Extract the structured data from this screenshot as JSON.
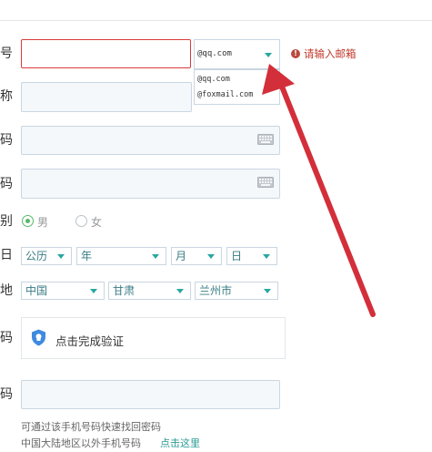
{
  "form": {
    "labels": {
      "email": "号",
      "nickname": "称",
      "password": "码",
      "confirm_password": "码",
      "gender": "别",
      "birthday": "日",
      "location": "地",
      "verify": "码",
      "phone": "码"
    },
    "email": {
      "input_value": "",
      "domain_selected": "@qq.com",
      "domain_options": [
        "@qq.com",
        "@foxmail.com"
      ],
      "error_text": "请输入邮箱"
    },
    "gender": {
      "options": [
        "男",
        "女"
      ],
      "selected": "男"
    },
    "birthday": {
      "calendar": "公历",
      "year": "年",
      "month": "月",
      "day": "日"
    },
    "location": {
      "country": "中国",
      "province": "甘肃",
      "city": "兰州市"
    },
    "verify": {
      "label": "点击完成验证"
    },
    "phone": {
      "hint": "可通过该手机号码快速找回密码",
      "foreign_text": "中国大陆地区以外手机号码",
      "foreign_link": "点击这里"
    }
  },
  "colors": {
    "error_border": "#d93b3b",
    "error_text": "#c0392b",
    "accent_teal": "#2aa7a0",
    "selected_green": "#55b96a",
    "arrow_red": "#d32f3a"
  },
  "icons": [
    "keyboard-icon",
    "error-icon",
    "chevron-down-icon",
    "shield-icon",
    "arrow-annotation"
  ]
}
